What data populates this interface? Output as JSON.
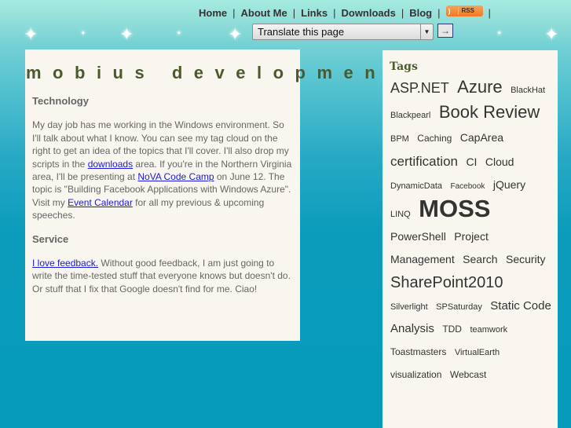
{
  "nav": {
    "items": [
      "Home",
      "About Me",
      "Links",
      "Downloads",
      "Blog"
    ],
    "separator": "|",
    "rss_label": "RSS"
  },
  "translate": {
    "selected": "Translate this page",
    "go_icon": "→"
  },
  "site_title": "mobius development",
  "main": {
    "sections": [
      {
        "heading": "Technology",
        "text_1": "My day job has me working in the Windows environment. So I'll talk about what I know. You can see my tag cloud on the right to get an idea of the topics that I'll cover. I'll also drop my scripts in the ",
        "link_1": "downloads",
        "text_2": " area. If you're in the Northern Virginia area, I'll be presenting at ",
        "link_2": "NoVA Code Camp",
        "text_3": " on June 12. The topic is \"Building Facebook Applications with Windows Azure\". Visit my ",
        "link_3": "Event Calendar",
        "text_4": " for all my previous & upcoming speeches."
      },
      {
        "heading": "Service",
        "link_1": "I love feedback.",
        "text_1": " Without good feedback, I am just going to write the time-tested stuff that everyone knows but doesn't do. Or stuff that I fix that Google doesn't find for me. Ciao!"
      }
    ]
  },
  "tags": {
    "title": "Tags",
    "items": [
      {
        "label": "ASP.NET",
        "size": 18
      },
      {
        "label": "Azure",
        "size": 22
      },
      {
        "label": "BlackHat",
        "size": 11
      },
      {
        "label": "Blackpearl",
        "size": 11
      },
      {
        "label": "Book Review",
        "size": 22
      },
      {
        "label": "BPM",
        "size": 11
      },
      {
        "label": "Caching",
        "size": 12
      },
      {
        "label": "CapArea",
        "size": 14
      },
      {
        "label": "certification",
        "size": 17
      },
      {
        "label": "CI",
        "size": 14
      },
      {
        "label": "Cloud",
        "size": 14
      },
      {
        "label": "DynamicData",
        "size": 11
      },
      {
        "label": "Facebook",
        "size": 10
      },
      {
        "label": "jQuery",
        "size": 14
      },
      {
        "label": "LINQ",
        "size": 11
      },
      {
        "label": "MOSS",
        "size": 31
      },
      {
        "label": "PowerShell",
        "size": 14
      },
      {
        "label": "Project Management",
        "size": 14
      },
      {
        "label": "Search",
        "size": 14
      },
      {
        "label": "Security",
        "size": 14
      },
      {
        "label": "SharePoint2010",
        "size": 20
      },
      {
        "label": "Silverlight",
        "size": 11
      },
      {
        "label": "SPSaturday",
        "size": 11
      },
      {
        "label": "Static Code Analysis",
        "size": 15
      },
      {
        "label": "TDD",
        "size": 12
      },
      {
        "label": "teamwork",
        "size": 11
      },
      {
        "label": "Toastmasters",
        "size": 12
      },
      {
        "label": "VirtualEarth",
        "size": 11
      },
      {
        "label": "visualization",
        "size": 12
      },
      {
        "label": "Webcast",
        "size": 12
      }
    ]
  },
  "colors": {
    "title": "#4a5a2e",
    "link": "#1a1adb",
    "panel": "#f8f6ee",
    "rss": "#ee7a22"
  }
}
